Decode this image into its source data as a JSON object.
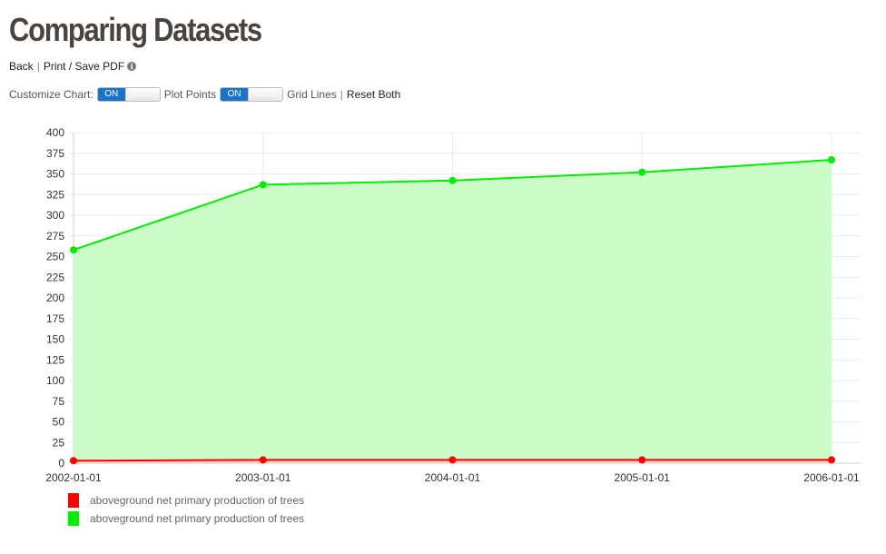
{
  "page": {
    "title": "Comparing Datasets",
    "back_label": "Back",
    "print_label": "Print / Save PDF",
    "customize_label": "Customize Chart:",
    "customize_toggle": "ON",
    "plot_points_label": "Plot Points",
    "plot_points_toggle": "ON",
    "grid_lines_label": "Grid Lines",
    "reset_label": "Reset Both"
  },
  "chart_data": {
    "type": "area",
    "x": [
      "2002-01-01",
      "2003-01-01",
      "2004-01-01",
      "2005-01-01",
      "2006-01-01"
    ],
    "ylim": [
      0,
      400
    ],
    "yticks": [
      0,
      25,
      50,
      75,
      100,
      125,
      150,
      175,
      200,
      225,
      250,
      275,
      300,
      325,
      350,
      375,
      400
    ],
    "grid": true,
    "legend_position": "bottom-left",
    "series": [
      {
        "name": "aboveground net primary production of trees",
        "color": "#ff0000",
        "fill": "#ffd0c8",
        "values": [
          3,
          4,
          4,
          4,
          4
        ]
      },
      {
        "name": "aboveground net primary production of trees",
        "color": "#00ee00",
        "fill": "#ccfcc8",
        "values": [
          258,
          337,
          342,
          352,
          367
        ]
      }
    ]
  }
}
